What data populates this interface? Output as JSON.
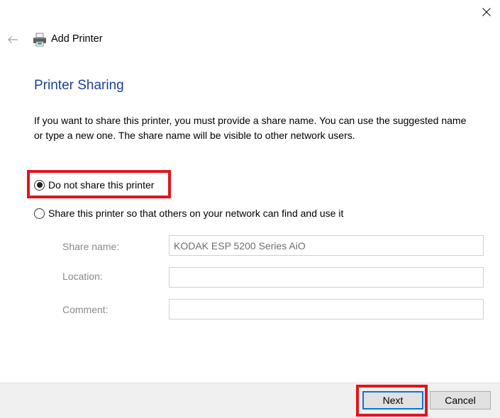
{
  "window": {
    "title": "Add Printer",
    "icons": {
      "back": "arrow-left-icon",
      "app": "printer-icon",
      "close": "close-icon"
    }
  },
  "page": {
    "heading": "Printer Sharing",
    "intro": "If you want to share this printer, you must provide a share name. You can use the suggested name or type a new one. The share name will be visible to other network users."
  },
  "sharing_options": [
    {
      "label": "Do not share this printer",
      "selected": true
    },
    {
      "label": "Share this printer so that others on your network can find and use it",
      "selected": false
    }
  ],
  "fields": {
    "share_name": {
      "label": "Share name:",
      "value": "KODAK ESP 5200 Series AiO"
    },
    "location": {
      "label": "Location:",
      "value": ""
    },
    "comment": {
      "label": "Comment:",
      "value": ""
    }
  },
  "footer": {
    "next_label": "Next",
    "cancel_label": "Cancel"
  },
  "colors": {
    "heading": "#1c3f94",
    "highlight": "#e3141d",
    "default_button_border": "#0078d7"
  }
}
